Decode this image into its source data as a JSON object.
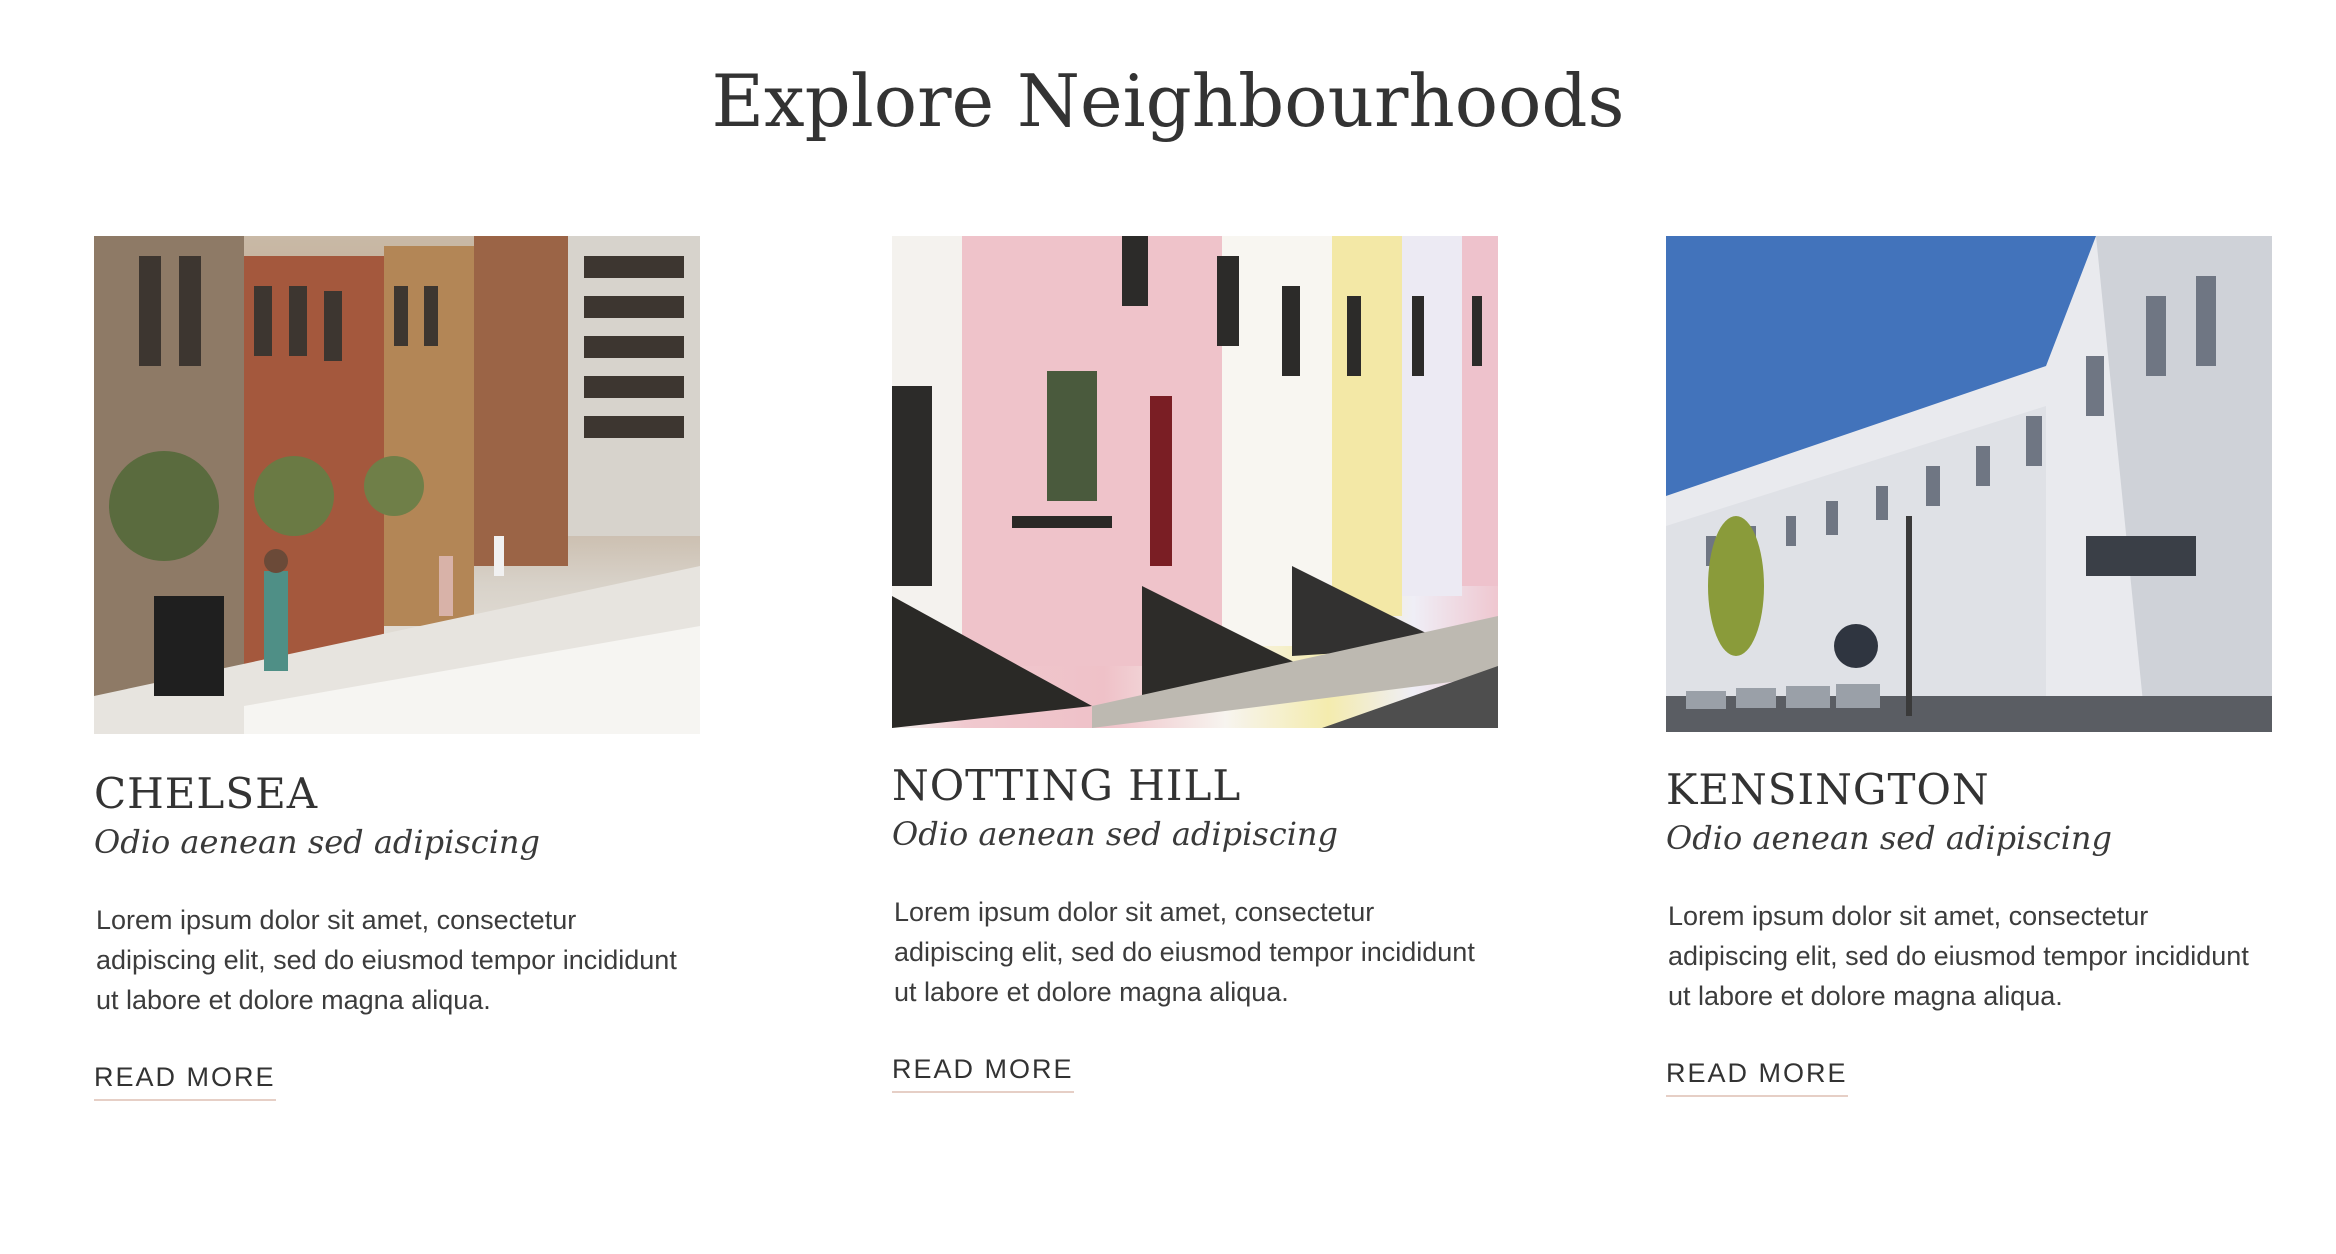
{
  "page": {
    "title": "Explore Neighbourhoods"
  },
  "cards": [
    {
      "name": "CHELSEA",
      "subtitle": "Odio aenean sed adipiscing",
      "body": "Lorem ipsum dolor sit amet, consectetur adipiscing elit, sed do eiusmod tempor incididunt ut labore et dolore magna aliqua.",
      "link": "READ MORE"
    },
    {
      "name": "NOTTING HILL",
      "subtitle": "Odio aenean sed adipiscing",
      "body": "Lorem ipsum dolor sit amet, consectetur adipiscing elit, sed do eiusmod tempor incididunt ut labore et dolore magna aliqua.",
      "link": "READ MORE"
    },
    {
      "name": "KENSINGTON",
      "subtitle": "Odio aenean sed adipiscing",
      "body": "Lorem ipsum dolor sit amet, consectetur adipiscing elit, sed do eiusmod tempor incididunt ut labore et dolore magna aliqua.",
      "link": "READ MORE"
    }
  ],
  "colors": {
    "text": "#333333",
    "link_underline": "#e6cfc6",
    "background": "#ffffff"
  }
}
